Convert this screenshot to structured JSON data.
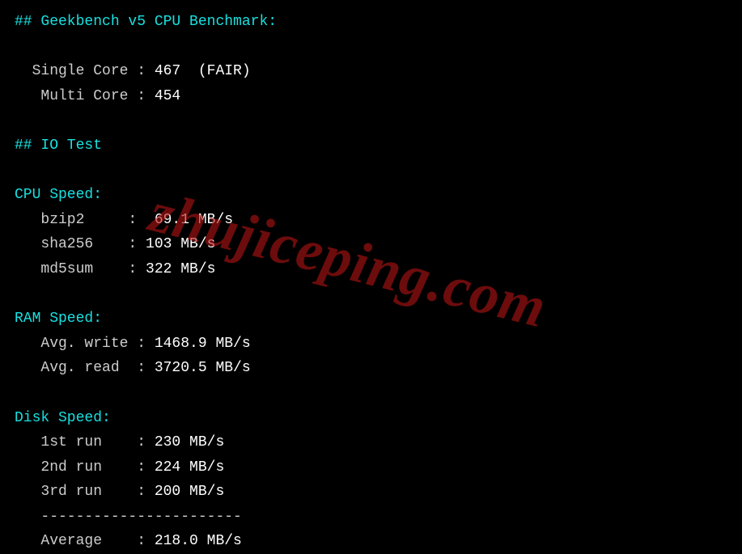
{
  "headers": {
    "geekbench": "## Geekbench v5 CPU Benchmark:",
    "iotest": "## IO Test"
  },
  "geekbench": {
    "single_label": "  Single Core : ",
    "single_value": "467",
    "single_rating": "  (FAIR)",
    "multi_label": "   Multi Core : ",
    "multi_value": "454"
  },
  "cpu": {
    "title": "CPU Speed:",
    "bzip2_label": "   bzip2     :  ",
    "bzip2_value": "69.1 MB/s",
    "sha256_label": "   sha256    : ",
    "sha256_value": "103 MB/s",
    "md5sum_label": "   md5sum    : ",
    "md5sum_value": "322 MB/s"
  },
  "ram": {
    "title": "RAM Speed:",
    "write_label": "   Avg. write : ",
    "write_value": "1468.9 MB/s",
    "read_label": "   Avg. read  : ",
    "read_value": "3720.5 MB/s"
  },
  "disk": {
    "title": "Disk Speed:",
    "run1_label": "   1st run    : ",
    "run1_value": "230 MB/s",
    "run2_label": "   2nd run    : ",
    "run2_value": "224 MB/s",
    "run3_label": "   3rd run    : ",
    "run3_value": "200 MB/s",
    "divider": "   -----------------------",
    "avg_label": "   Average    : ",
    "avg_value": "218.0 MB/s"
  },
  "watermark": "zhujiceping.com"
}
